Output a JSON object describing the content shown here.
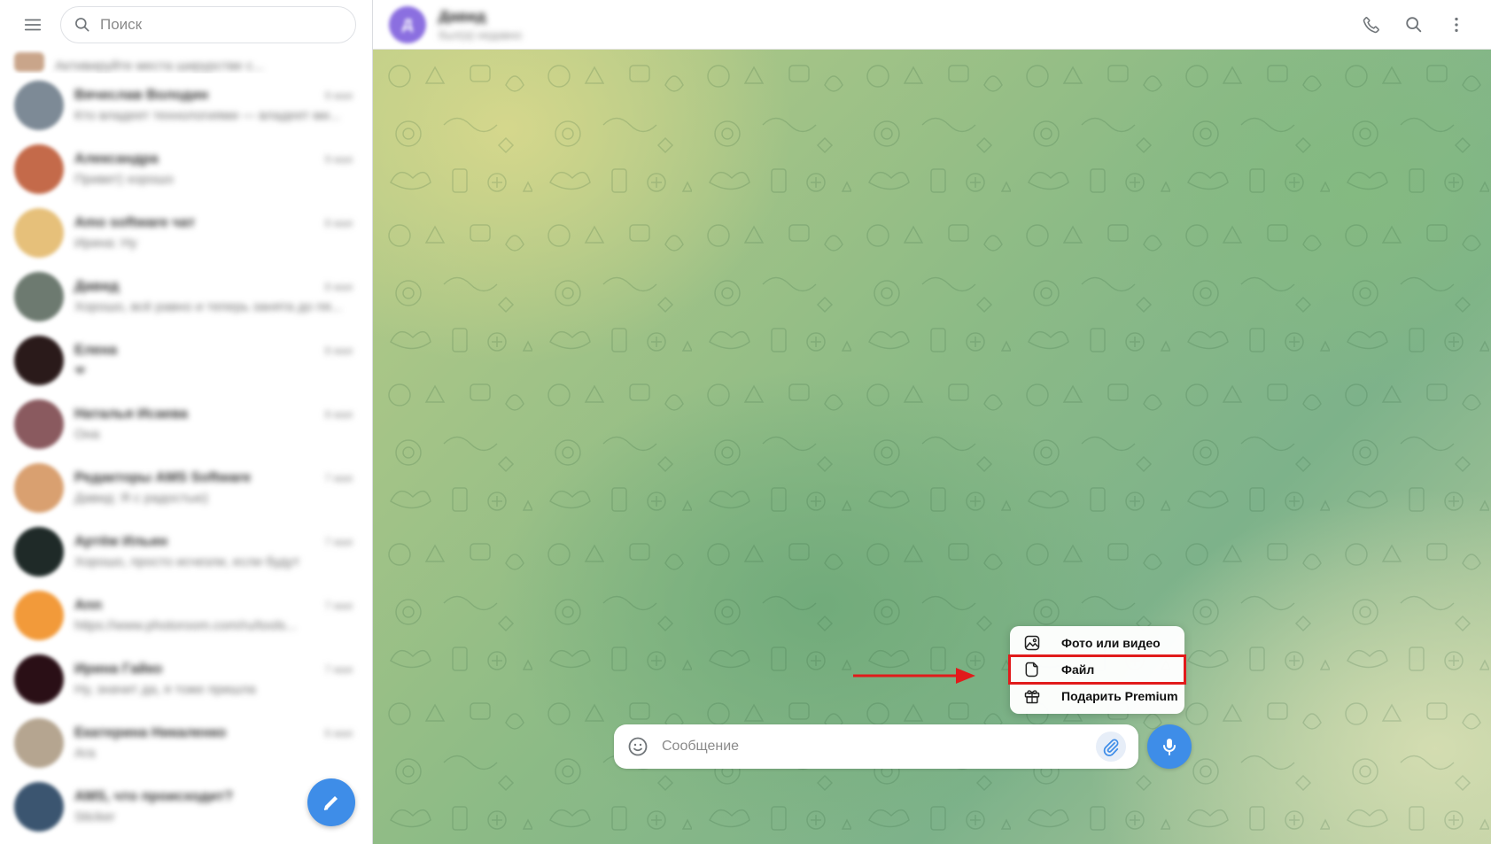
{
  "sidebar": {
    "search_placeholder": "Поиск",
    "chats": [
      {
        "name": "",
        "preview": "Активируйте места ширурстве с...",
        "time": "",
        "avatar_color": "#c9a58a",
        "partial": true
      },
      {
        "name": "Вячеслав Володин",
        "preview": "Кто владеет технологиями — владеет ми...",
        "time": "9 мая",
        "avatar_color": "#7d8a96"
      },
      {
        "name": "Александра",
        "preview": "Привет) хорошо",
        "time": "9 мая",
        "avatar_color": "#c46a4a"
      },
      {
        "name": "Amo software чат",
        "preview": "Ирина: Ну",
        "time": "8 мая",
        "avatar_color": "#e6c07a"
      },
      {
        "name": "Давид",
        "preview": "Хорошо, всё равно и теперь занята до пя...",
        "time": "8 мая",
        "avatar_color": "#6d7a70"
      },
      {
        "name": "Елена",
        "preview": "❤",
        "time": "8 мая",
        "avatar_color": "#2a1a1a"
      },
      {
        "name": "Наталья Исаева",
        "preview": "Она",
        "time": "8 мая",
        "avatar_color": "#8a5a5f"
      },
      {
        "name": "Редакторы AMS Software",
        "preview": "Давид: Я с радостью)",
        "time": "7 мая",
        "avatar_color": "#d9a070"
      },
      {
        "name": "Артём Ильин",
        "preview": "Хорошо, просто исчезли, если будут",
        "time": "7 мая",
        "avatar_color": "#1f2a28"
      },
      {
        "name": "Ann",
        "preview": "https://www.photoroom.com/ru/tools...",
        "time": "7 мая",
        "avatar_color": "#f29a3a"
      },
      {
        "name": "Ирина Гайко",
        "preview": "Ну, значит да, я тоже пришла",
        "time": "7 мая",
        "avatar_color": "#2a0f16"
      },
      {
        "name": "Екатерина Никаленко",
        "preview": "Ага",
        "time": "6 мая",
        "avatar_color": "#b5a590"
      },
      {
        "name": "AMS, что происходит?",
        "preview": "Sticker",
        "time": "",
        "avatar_color": "#3b5570"
      }
    ]
  },
  "chat": {
    "peer_name": "Давид",
    "peer_initial": "Д",
    "peer_status": "был(а) недавно",
    "composer_placeholder": "Сообщение"
  },
  "attach_menu": {
    "items": [
      {
        "label": "Фото или видео",
        "icon": "photo-icon"
      },
      {
        "label": "Файл",
        "icon": "file-icon",
        "highlighted": true
      },
      {
        "label": "Подарить Premium",
        "icon": "gift-icon"
      }
    ]
  },
  "colors": {
    "accent": "#3e8de8",
    "highlight": "#e11b1b"
  }
}
